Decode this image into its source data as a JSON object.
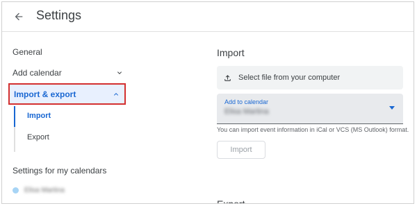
{
  "header": {
    "title": "Settings"
  },
  "sidebar": {
    "general": "General",
    "add_calendar": "Add calendar",
    "import_export": "Import & export",
    "sub": {
      "import": "Import",
      "export": "Export"
    },
    "my_calendars_heading": "Settings for my calendars",
    "calendar_entry": "Elisa Martina"
  },
  "main": {
    "import_title": "Import",
    "file_button": "Select file from your computer",
    "add_to_calendar_label": "Add to calendar",
    "add_to_calendar_value": "Elisa Martina",
    "help_text": "You can import event information in iCal or VCS (MS Outlook) format.",
    "import_button": "Import",
    "export_title": "Export"
  },
  "colors": {
    "accent": "#1967d2",
    "highlight_border": "#d32f2f",
    "selected_bg": "#e8f0fe"
  }
}
